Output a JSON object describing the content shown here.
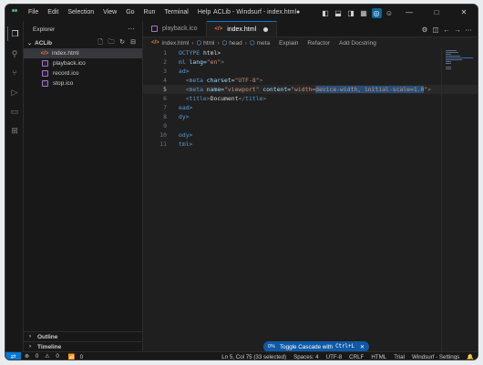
{
  "titlebar": {
    "menus": [
      "File",
      "Edit",
      "Selection",
      "View",
      "Go",
      "Run",
      "Terminal",
      "Help"
    ],
    "title": "ACLib - Windsurf - index.html●",
    "buttons": {
      "minimize": "—",
      "maximize": "□",
      "close": "✕"
    }
  },
  "sidebar": {
    "title": "Explorer",
    "more": "···",
    "project": "ACLib",
    "files": [
      {
        "name": "index.html",
        "type": "html"
      },
      {
        "name": "playback.ico",
        "type": "image"
      },
      {
        "name": "record.ico",
        "type": "image"
      },
      {
        "name": "stop.ico",
        "type": "image"
      }
    ],
    "outline": "Outline",
    "timeline": "Timeline"
  },
  "editor": {
    "tabs": [
      {
        "label": "playback.ico"
      },
      {
        "label": "index.html"
      }
    ],
    "breadcrumb": [
      "index.html",
      "html",
      "head",
      "meta"
    ],
    "lens": [
      "Explain",
      "Refactor",
      "Add Docstring"
    ],
    "line_numbers": [
      "1",
      "2",
      "3",
      "4",
      "5",
      "6",
      "7",
      "8",
      "9",
      "10",
      "11"
    ],
    "lines": [
      [
        "OCTYPE",
        " html>"
      ],
      [
        "ml",
        " lang=",
        "\"en\"",
        ">"
      ],
      [
        "ad>"
      ],
      [
        "  <",
        "meta",
        " charset=",
        "\"UTF-8\"",
        ">"
      ],
      [
        "  <",
        "meta",
        " name=",
        "\"viewport\"",
        " content=",
        "\"width=",
        "device-width, initial-scale=1.0",
        "\"",
        ">"
      ],
      [
        "  <",
        "title",
        ">",
        "Document",
        "</",
        "title",
        ">"
      ],
      [
        "ead>"
      ],
      [
        "dy>"
      ],
      [
        ""
      ],
      [
        "ody>"
      ],
      [
        "tml>"
      ]
    ]
  },
  "cascade": {
    "pct": "0%",
    "label": "Toggle Cascade with",
    "shortcut": "Ctrl+L",
    "close": "✕"
  },
  "status": {
    "errors": "0",
    "warnings": "0",
    "ports": "0",
    "position": "Ln 5, Col 75 (33 selected)",
    "spaces": "Spaces: 4",
    "encoding": "UTF-8",
    "eol": "CRLF",
    "language": "HTML",
    "trial": "Trial",
    "settings": "Windsurf - Settings"
  },
  "colors": {
    "accent": "#0078d4",
    "html_icon": "#e37933",
    "image_icon": "#a074c4",
    "tag": "#569cd6",
    "attr": "#9cdcfe",
    "string": "#ce9178"
  }
}
